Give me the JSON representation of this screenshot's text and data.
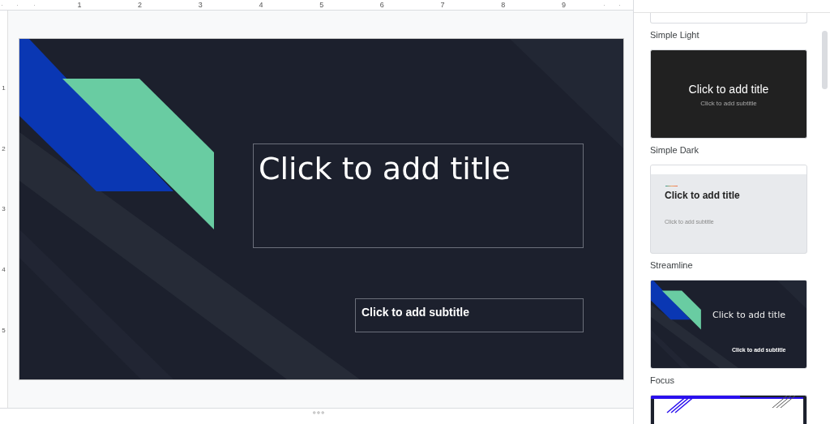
{
  "ruler": {
    "horizontal": [
      "1",
      "2",
      "3",
      "4",
      "5",
      "6",
      "7",
      "8",
      "9"
    ],
    "vertical": [
      "1",
      "2",
      "3",
      "4",
      "5"
    ]
  },
  "slide": {
    "title_placeholder": "Click to add title",
    "subtitle_placeholder": "Click to add subtitle"
  },
  "themes_panel": {
    "themes": [
      {
        "kind": "plain-white",
        "name": "Simple Light"
      },
      {
        "kind": "simple-dark",
        "name": "Simple Dark",
        "title": "Click to add title",
        "subtitle": "Click to add subtitle"
      },
      {
        "kind": "streamline",
        "name": "Streamline",
        "title": "Click to add title",
        "subtitle": "Click to add subtitle"
      },
      {
        "kind": "focus",
        "name": "Focus",
        "title": "Click to add title",
        "subtitle": "Click to add subtitle"
      },
      {
        "kind": "bold-frame"
      }
    ]
  }
}
